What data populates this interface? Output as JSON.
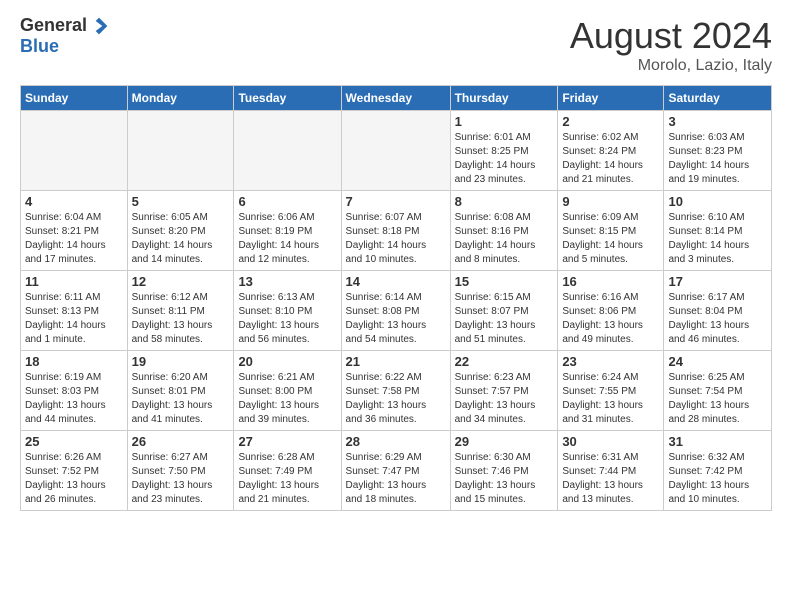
{
  "logo": {
    "general": "General",
    "blue": "Blue"
  },
  "title": "August 2024",
  "subtitle": "Morolo, Lazio, Italy",
  "days": [
    "Sunday",
    "Monday",
    "Tuesday",
    "Wednesday",
    "Thursday",
    "Friday",
    "Saturday"
  ],
  "weeks": [
    [
      {
        "day": "",
        "info": ""
      },
      {
        "day": "",
        "info": ""
      },
      {
        "day": "",
        "info": ""
      },
      {
        "day": "",
        "info": ""
      },
      {
        "day": "1",
        "info": "Sunrise: 6:01 AM\nSunset: 8:25 PM\nDaylight: 14 hours\nand 23 minutes."
      },
      {
        "day": "2",
        "info": "Sunrise: 6:02 AM\nSunset: 8:24 PM\nDaylight: 14 hours\nand 21 minutes."
      },
      {
        "day": "3",
        "info": "Sunrise: 6:03 AM\nSunset: 8:23 PM\nDaylight: 14 hours\nand 19 minutes."
      }
    ],
    [
      {
        "day": "4",
        "info": "Sunrise: 6:04 AM\nSunset: 8:21 PM\nDaylight: 14 hours\nand 17 minutes."
      },
      {
        "day": "5",
        "info": "Sunrise: 6:05 AM\nSunset: 8:20 PM\nDaylight: 14 hours\nand 14 minutes."
      },
      {
        "day": "6",
        "info": "Sunrise: 6:06 AM\nSunset: 8:19 PM\nDaylight: 14 hours\nand 12 minutes."
      },
      {
        "day": "7",
        "info": "Sunrise: 6:07 AM\nSunset: 8:18 PM\nDaylight: 14 hours\nand 10 minutes."
      },
      {
        "day": "8",
        "info": "Sunrise: 6:08 AM\nSunset: 8:16 PM\nDaylight: 14 hours\nand 8 minutes."
      },
      {
        "day": "9",
        "info": "Sunrise: 6:09 AM\nSunset: 8:15 PM\nDaylight: 14 hours\nand 5 minutes."
      },
      {
        "day": "10",
        "info": "Sunrise: 6:10 AM\nSunset: 8:14 PM\nDaylight: 14 hours\nand 3 minutes."
      }
    ],
    [
      {
        "day": "11",
        "info": "Sunrise: 6:11 AM\nSunset: 8:13 PM\nDaylight: 14 hours\nand 1 minute."
      },
      {
        "day": "12",
        "info": "Sunrise: 6:12 AM\nSunset: 8:11 PM\nDaylight: 13 hours\nand 58 minutes."
      },
      {
        "day": "13",
        "info": "Sunrise: 6:13 AM\nSunset: 8:10 PM\nDaylight: 13 hours\nand 56 minutes."
      },
      {
        "day": "14",
        "info": "Sunrise: 6:14 AM\nSunset: 8:08 PM\nDaylight: 13 hours\nand 54 minutes."
      },
      {
        "day": "15",
        "info": "Sunrise: 6:15 AM\nSunset: 8:07 PM\nDaylight: 13 hours\nand 51 minutes."
      },
      {
        "day": "16",
        "info": "Sunrise: 6:16 AM\nSunset: 8:06 PM\nDaylight: 13 hours\nand 49 minutes."
      },
      {
        "day": "17",
        "info": "Sunrise: 6:17 AM\nSunset: 8:04 PM\nDaylight: 13 hours\nand 46 minutes."
      }
    ],
    [
      {
        "day": "18",
        "info": "Sunrise: 6:19 AM\nSunset: 8:03 PM\nDaylight: 13 hours\nand 44 minutes."
      },
      {
        "day": "19",
        "info": "Sunrise: 6:20 AM\nSunset: 8:01 PM\nDaylight: 13 hours\nand 41 minutes."
      },
      {
        "day": "20",
        "info": "Sunrise: 6:21 AM\nSunset: 8:00 PM\nDaylight: 13 hours\nand 39 minutes."
      },
      {
        "day": "21",
        "info": "Sunrise: 6:22 AM\nSunset: 7:58 PM\nDaylight: 13 hours\nand 36 minutes."
      },
      {
        "day": "22",
        "info": "Sunrise: 6:23 AM\nSunset: 7:57 PM\nDaylight: 13 hours\nand 34 minutes."
      },
      {
        "day": "23",
        "info": "Sunrise: 6:24 AM\nSunset: 7:55 PM\nDaylight: 13 hours\nand 31 minutes."
      },
      {
        "day": "24",
        "info": "Sunrise: 6:25 AM\nSunset: 7:54 PM\nDaylight: 13 hours\nand 28 minutes."
      }
    ],
    [
      {
        "day": "25",
        "info": "Sunrise: 6:26 AM\nSunset: 7:52 PM\nDaylight: 13 hours\nand 26 minutes."
      },
      {
        "day": "26",
        "info": "Sunrise: 6:27 AM\nSunset: 7:50 PM\nDaylight: 13 hours\nand 23 minutes."
      },
      {
        "day": "27",
        "info": "Sunrise: 6:28 AM\nSunset: 7:49 PM\nDaylight: 13 hours\nand 21 minutes."
      },
      {
        "day": "28",
        "info": "Sunrise: 6:29 AM\nSunset: 7:47 PM\nDaylight: 13 hours\nand 18 minutes."
      },
      {
        "day": "29",
        "info": "Sunrise: 6:30 AM\nSunset: 7:46 PM\nDaylight: 13 hours\nand 15 minutes."
      },
      {
        "day": "30",
        "info": "Sunrise: 6:31 AM\nSunset: 7:44 PM\nDaylight: 13 hours\nand 13 minutes."
      },
      {
        "day": "31",
        "info": "Sunrise: 6:32 AM\nSunset: 7:42 PM\nDaylight: 13 hours\nand 10 minutes."
      }
    ]
  ]
}
